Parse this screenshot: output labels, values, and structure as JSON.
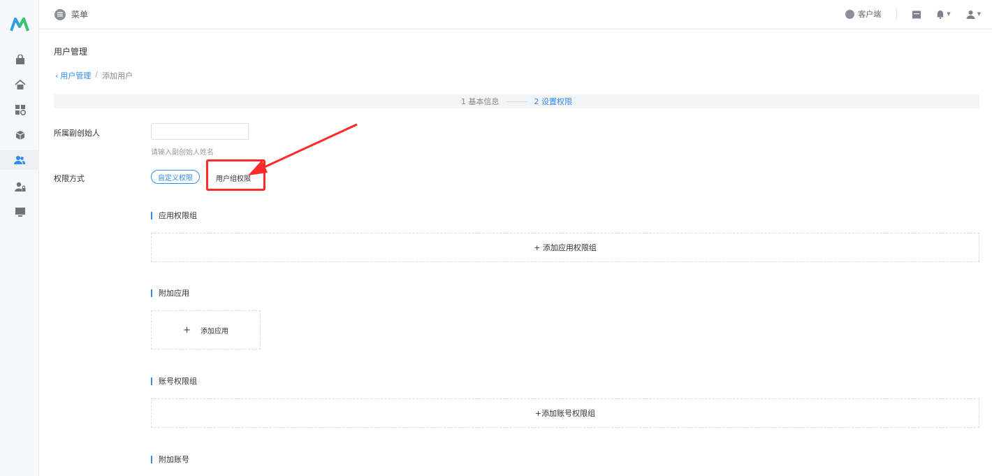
{
  "topbar": {
    "menu_label": "菜单",
    "client_label": "客户端"
  },
  "page": {
    "title": "用户管理",
    "breadcrumb": {
      "back": "用户管理",
      "separator": "/",
      "current": "添加用户"
    }
  },
  "steps": {
    "step1": "1 基本信息",
    "step2": "2 设置权限",
    "active_color": "#2d8cf0"
  },
  "form": {
    "owner_label": "所属副创始人",
    "owner_value": "",
    "owner_hint": "请输入副创始人姓名",
    "mode_label": "权限方式",
    "mode_custom": "自定义权限",
    "mode_group": "用户组权限"
  },
  "sections": {
    "app_group": {
      "title": "应用权限组",
      "add_label": "+ 添加应用权限组"
    },
    "extra_app": {
      "title": "附加应用",
      "add_plus": "+",
      "add_label": "添加应用"
    },
    "account_group": {
      "title": "账号权限组",
      "add_label": "+添加账号权限组"
    },
    "extra_account": {
      "title": "附加账号"
    }
  },
  "annotation": {
    "highlight_color": "#ff2a2a"
  },
  "sidebar": {
    "icons": [
      "bag-icon",
      "home-icon",
      "apps-icon",
      "package-icon",
      "users-icon",
      "user-lock-icon",
      "monitor-icon"
    ],
    "active": "users-icon"
  }
}
